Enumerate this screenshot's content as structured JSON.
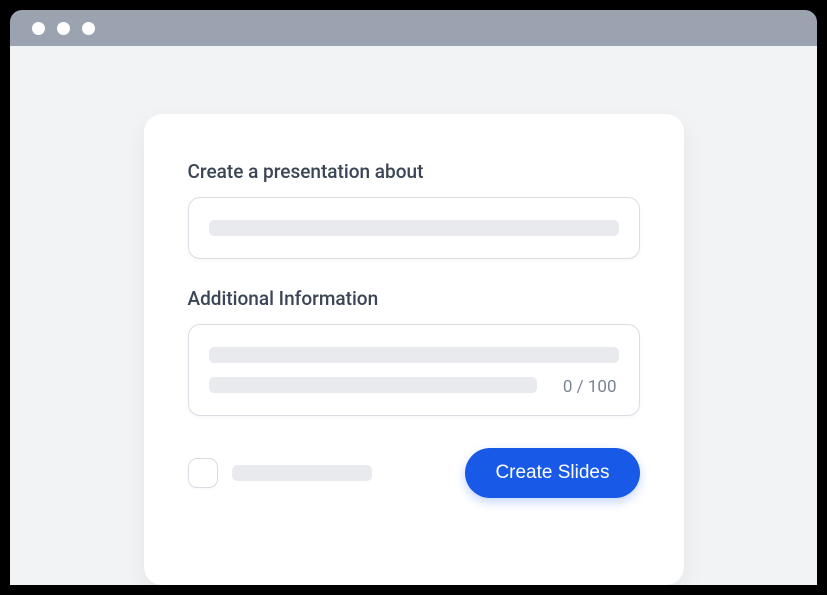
{
  "form": {
    "topic": {
      "label": "Create a presentation about",
      "value": ""
    },
    "additional": {
      "label": "Additional Information",
      "value": "",
      "counter": "0 / 100"
    },
    "checkbox": {
      "checked": false
    },
    "submit": {
      "label": "Create Slides"
    }
  }
}
